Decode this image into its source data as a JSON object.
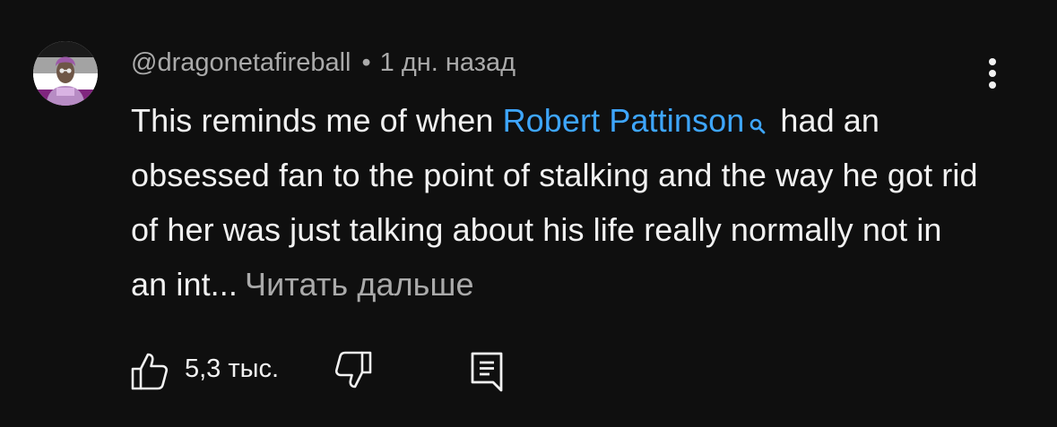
{
  "comment": {
    "author": "@dragonetafireball",
    "separator": "•",
    "timestamp": "1 дн. назад",
    "text_before_link": "This reminds me of when ",
    "link_text": "Robert Pattinson",
    "link_icon": "search-icon",
    "text_after_link": "had an obsessed fan to the point of stalking and the way he got rid of her was just talking about his life really normally not in an int...",
    "read_more_label": "Читать дальше",
    "like_count": "5,3 тыс.",
    "icons": {
      "like": "thumbs-up-icon",
      "dislike": "thumbs-down-icon",
      "reply": "reply-comment-icon",
      "more": "more-vertical-icon"
    },
    "colors": {
      "background": "#0f0f0f",
      "text": "#f1f1f1",
      "secondary_text": "#aaaaaa",
      "link": "#3ea6ff"
    }
  }
}
